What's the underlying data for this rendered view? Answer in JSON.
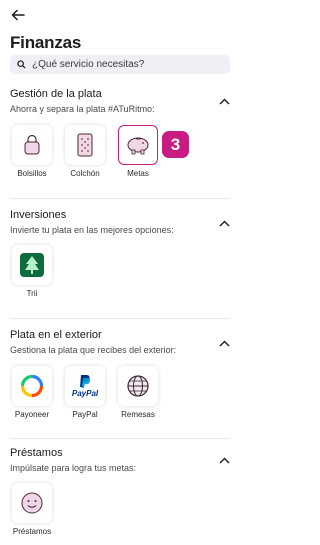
{
  "header": {
    "title": "Finanzas"
  },
  "search": {
    "placeholder": "¿Qué servicio necesitas?"
  },
  "sections": [
    {
      "title": "Gestión de la plata",
      "subtitle": "Ahorra y separa la plata #ATuRitmo:",
      "items": [
        {
          "label": "Bolsillos",
          "icon": "lock-icon"
        },
        {
          "label": "Colchón",
          "icon": "mattress-icon"
        },
        {
          "label": "Metas",
          "icon": "piggy-bank-icon",
          "selected": true
        }
      ],
      "badge": "3"
    },
    {
      "title": "Inversiones",
      "subtitle": "Invierte tu plata en las mejores opciones:",
      "items": [
        {
          "label": "Trii",
          "icon": "tree-icon"
        }
      ]
    },
    {
      "title": "Plata en el exterior",
      "subtitle": "Gestiona la plata que recibes del exterior:",
      "items": [
        {
          "label": "Payoneer",
          "icon": "payoneer-logo"
        },
        {
          "label": "PayPal",
          "icon": "paypal-logo",
          "logo_text": "PayPal"
        },
        {
          "label": "Remesas",
          "icon": "globe-icon"
        }
      ]
    },
    {
      "title": "Préstamos",
      "subtitle": "Impúlsate para logra tus metas:",
      "items": [
        {
          "label": "Préstamos",
          "icon": "smiley-icon"
        }
      ]
    }
  ],
  "colors": {
    "accent": "#c81c83",
    "trii_green": "#0d6b3d",
    "paypal_dark": "#003087",
    "paypal_light": "#009cde"
  }
}
